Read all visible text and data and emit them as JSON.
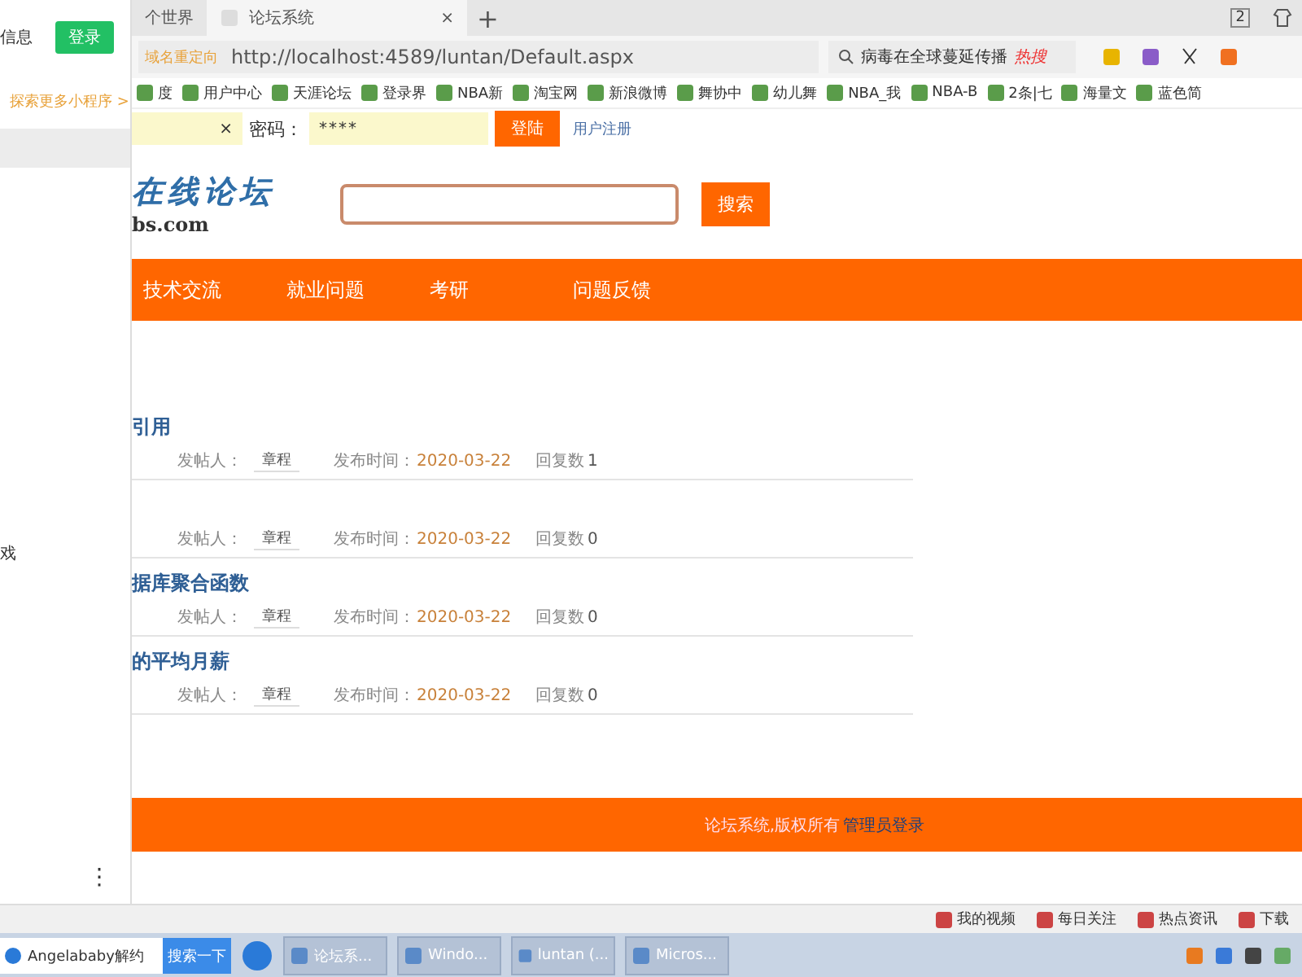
{
  "side_panel": {
    "label": "信息",
    "login_button": "登录",
    "explore_link": "探索更多小程序 >",
    "item": "戏",
    "more": "⋮"
  },
  "tabs": [
    {
      "label": "个世界",
      "selected": false
    },
    {
      "label": "论坛系统",
      "selected": true
    }
  ],
  "tab_close": "×",
  "new_tab": "+",
  "window_count": "2",
  "address_bar": {
    "badge": "域名重定向",
    "url": "http://localhost:4589/luntan/Default.aspx"
  },
  "browser_search": {
    "value": "病毒在全球蔓延传播",
    "hot": "热搜"
  },
  "bookmarks": [
    "度",
    "用户中心",
    "天涯论坛",
    "登录界",
    "NBA新",
    "淘宝网",
    "新浪微博",
    "舞协中",
    "幼儿舞",
    "NBA_我",
    "NBA-B",
    "2条|七",
    "海量文",
    "蓝色简"
  ],
  "login": {
    "clear": "×",
    "password_label": "密码：",
    "password": "****",
    "login_button": "登陆",
    "register_link": "用户注册"
  },
  "logo": {
    "title": "在线论坛",
    "domain": "bs.com"
  },
  "search_button": "搜索",
  "nav": [
    "技术交流",
    "就业问题",
    "考研",
    "问题反馈"
  ],
  "posts": [
    {
      "title": "引用",
      "poster_label": "发帖人：",
      "poster": "章程",
      "time_label": "发布时间：",
      "time": "2020-03-22",
      "replies_label": "回复数",
      "replies": "1"
    },
    {
      "poster_label": "发帖人：",
      "poster": "章程",
      "time_label": "发布时间：",
      "time": "2020-03-22",
      "replies_label": "回复数",
      "replies": "0"
    },
    {
      "title": "据库聚合函数",
      "poster_label": "发帖人：",
      "poster": "章程",
      "time_label": "发布时间：",
      "time": "2020-03-22",
      "replies_label": "回复数",
      "replies": "0"
    },
    {
      "title": "的平均月薪",
      "poster_label": "发帖人：",
      "poster": "章程",
      "time_label": "发布时间：",
      "time": "2020-03-22",
      "replies_label": "回复数",
      "replies": "0"
    }
  ],
  "footer": {
    "text": "论坛系统,版权所有",
    "admin_link": "管理员登录"
  },
  "status_bar": [
    "我的视频",
    "每日关注",
    "热点资讯",
    "下载"
  ],
  "taskbar": {
    "search": "Angelababy解约",
    "search_button": "搜索一下",
    "tasks": [
      "论坛系...",
      "Windo...",
      "luntan (...",
      "Micros..."
    ]
  }
}
